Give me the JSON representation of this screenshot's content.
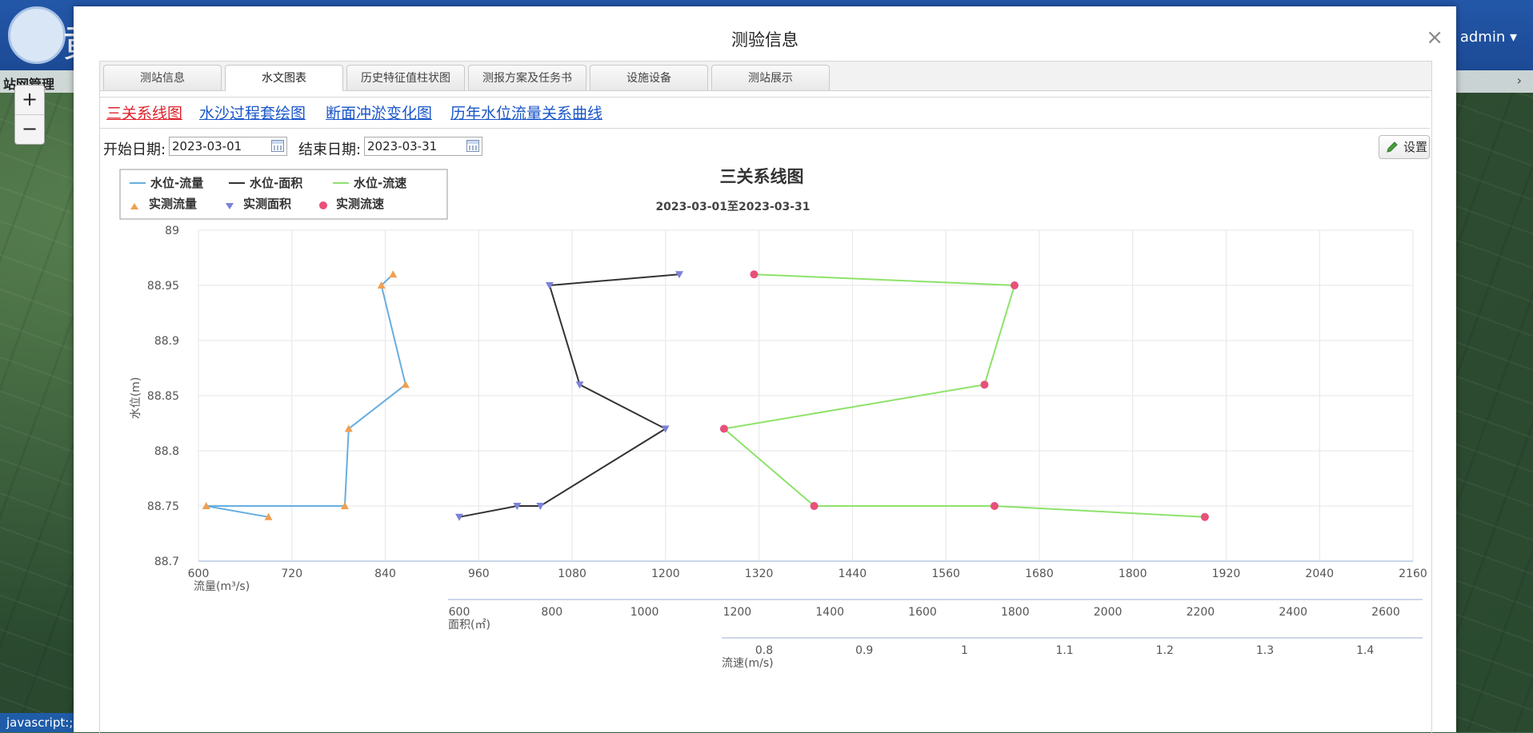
{
  "header": {
    "logo_char": "黄",
    "user": "admin",
    "nav_label": "站网管理",
    "chevron": "›"
  },
  "map_controls": {
    "zoom_in": "+",
    "zoom_out": "−"
  },
  "status_bar": "javascript:;",
  "modal": {
    "title": "测验信息",
    "close": "×",
    "tabs": [
      {
        "label": "测站信息"
      },
      {
        "label": "水文图表"
      },
      {
        "label": "历史特征值柱状图"
      },
      {
        "label": "测报方案及任务书"
      },
      {
        "label": "设施设备"
      },
      {
        "label": "测站展示"
      }
    ],
    "active_tab": 1,
    "subtabs": [
      {
        "label": "三关系线图"
      },
      {
        "label": "水沙过程套绘图"
      },
      {
        "label": "断面冲淤变化图"
      },
      {
        "label": "历年水位流量关系曲线"
      }
    ],
    "active_subtab": 0,
    "filters": {
      "start_label": "开始日期:",
      "start_value": "2023-03-01",
      "end_label": "结束日期:",
      "end_value": "2023-03-31",
      "settings_label": "设置"
    }
  },
  "chart_data": {
    "type": "line",
    "title": "三关系线图",
    "subtitle": "2023-03-01至2023-03-31",
    "ylabel": "水位(m)",
    "ylim": [
      88.7,
      89
    ],
    "yticks": [
      "89",
      "88.95",
      "88.9",
      "88.85",
      "88.8",
      "88.75",
      "88.7"
    ],
    "grid": true,
    "legend_position": "top-left",
    "colors": {
      "flow": "#66aee0",
      "area": "#333333",
      "velocity": "#8de26b",
      "flow_marker": "#f0a050",
      "area_marker": "#7b82d8",
      "velocity_marker": "#e8507a"
    },
    "legend": [
      "水位-流量",
      "水位-面积",
      "水位-流速",
      "实测流量",
      "实测面积",
      "实测流速"
    ],
    "axes": [
      {
        "name": "流量(m³/s)",
        "min": 600,
        "max": 2160,
        "ticks": [
          "600",
          "720",
          "840",
          "960",
          "1080",
          "1200",
          "1320",
          "1440",
          "1560",
          "1680",
          "1800",
          "1920",
          "2040",
          "2160"
        ]
      },
      {
        "name": "面积(㎡)",
        "min": 400,
        "max": 2700,
        "ticks": [
          "600",
          "800",
          "1000",
          "1200",
          "1400",
          "1600",
          "1800",
          "2000",
          "2200",
          "2400",
          "2600"
        ]
      },
      {
        "name": "流速(m/s)",
        "min": 0.75,
        "max": 1.45,
        "ticks": [
          "0.8",
          "0.9",
          "1",
          "1.1",
          "1.2",
          "1.3",
          "1.4"
        ]
      }
    ],
    "series": [
      {
        "name": "水位-流量",
        "axis": 0,
        "x": [
          690,
          610,
          788,
          793,
          866,
          835,
          850
        ],
        "y": [
          88.74,
          88.75,
          88.75,
          88.82,
          88.86,
          88.95,
          88.96
        ]
      },
      {
        "name": "水位-面积",
        "axis": 1,
        "x": [
          600,
          725,
          775,
          1045,
          860,
          795,
          1075
        ],
        "y": [
          88.74,
          88.75,
          88.75,
          88.82,
          88.86,
          88.95,
          88.96
        ]
      },
      {
        "name": "水位-流速",
        "axis": 2,
        "x": [
          1.24,
          1.03,
          0.85,
          0.76,
          1.02,
          1.05,
          0.79
        ],
        "y": [
          88.74,
          88.75,
          88.75,
          88.82,
          88.86,
          88.95,
          88.96
        ]
      }
    ]
  }
}
